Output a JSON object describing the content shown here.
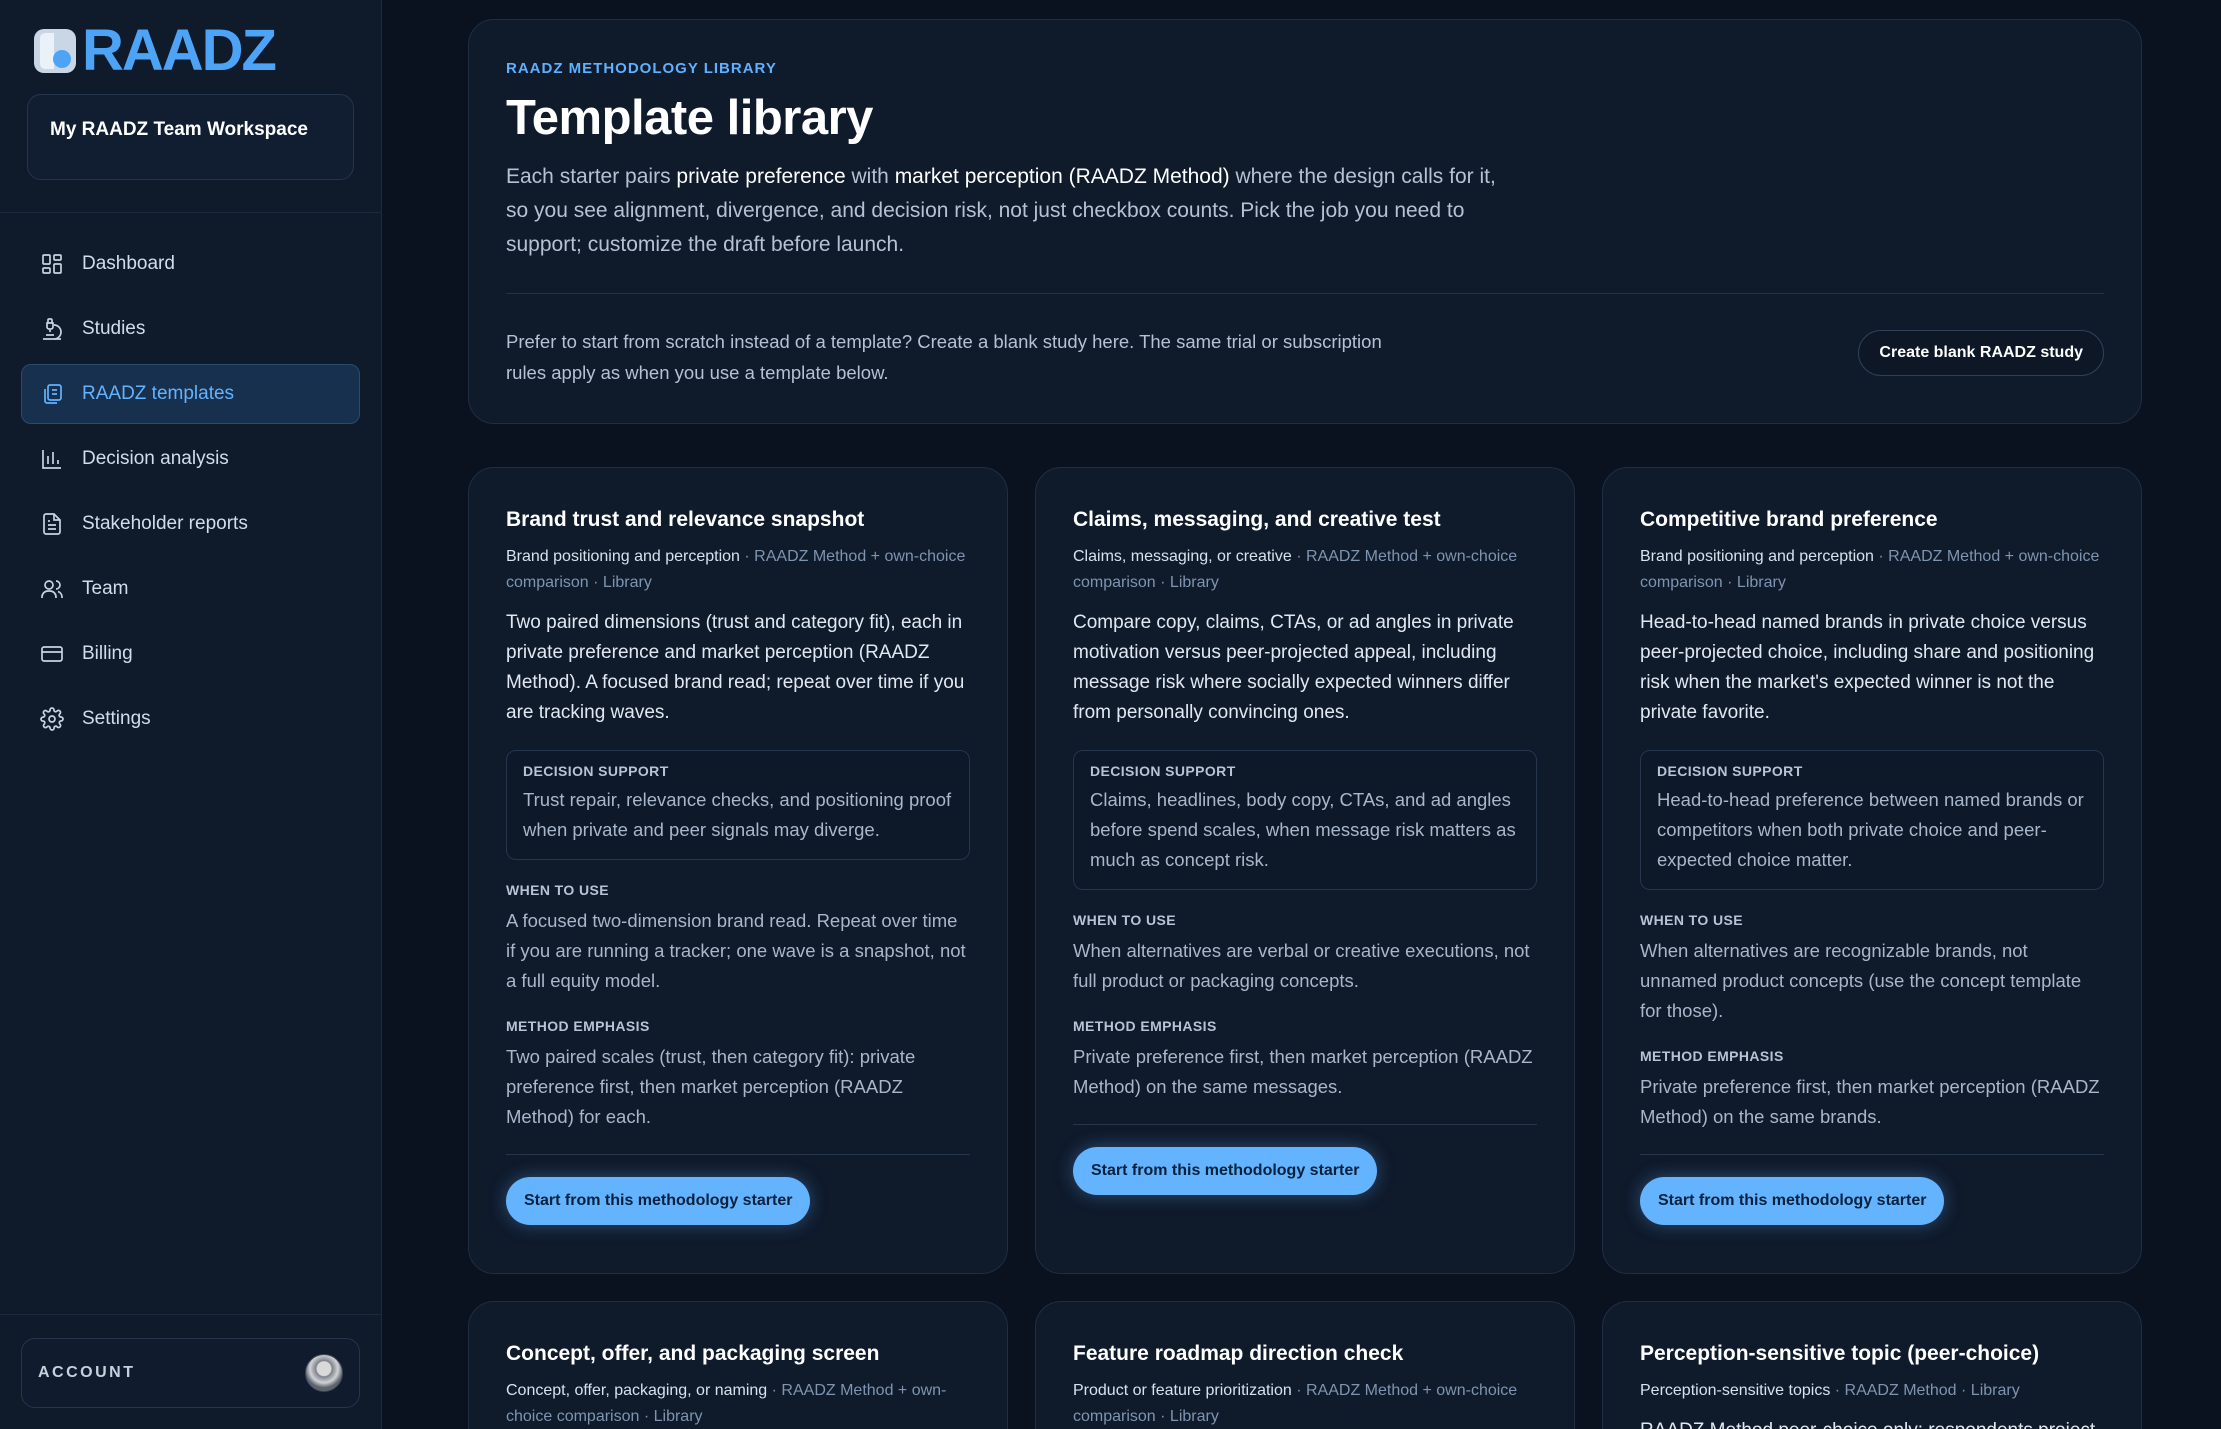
{
  "brand": {
    "name": "RAADZ",
    "accent": "#4da3f5"
  },
  "workspace": {
    "name": "My RAADZ Team Workspace"
  },
  "nav": {
    "items": [
      {
        "label": "Dashboard",
        "icon": "dashboard-grid-icon"
      },
      {
        "label": "Studies",
        "icon": "microscope-icon"
      },
      {
        "label": "RAADZ templates",
        "icon": "templates-icon",
        "active": true
      },
      {
        "label": "Decision analysis",
        "icon": "bar-chart-icon"
      },
      {
        "label": "Stakeholder reports",
        "icon": "document-icon"
      },
      {
        "label": "Team",
        "icon": "users-icon"
      },
      {
        "label": "Billing",
        "icon": "credit-card-icon"
      },
      {
        "label": "Settings",
        "icon": "gear-icon"
      }
    ]
  },
  "account": {
    "label": "ACCOUNT"
  },
  "hero": {
    "eyebrow": "RAADZ METHODOLOGY LIBRARY",
    "title": "Template library",
    "desc_1": "Each starter pairs ",
    "desc_bold_1": "private preference",
    "desc_2": " with ",
    "desc_bold_2": "market perception (RAADZ Method)",
    "desc_3": " where the design calls for it, so you see alignment, divergence, and decision risk, not just checkbox counts. Pick the job you need to support; customize the draft before launch.",
    "blank_text": "Prefer to start from scratch instead of a template? Create a blank study here. The same trial or subscription rules apply as when you use a template below.",
    "blank_button": "Create blank RAADZ study"
  },
  "labels": {
    "decision_support": "DECISION SUPPORT",
    "when_to_use": "WHEN TO USE",
    "method_emphasis": "METHOD EMPHASIS",
    "start_button": "Start from this methodology starter"
  },
  "cards": [
    {
      "title": "Brand trust and relevance snapshot",
      "category": "Brand positioning and perception",
      "meta": " · RAADZ Method + own-choice comparison · Library",
      "desc": "Two paired dimensions (trust and category fit), each in private preference and market perception (RAADZ Method). A focused brand read; repeat over time if you are tracking waves.",
      "decision": "Trust repair, relevance checks, and positioning proof when private and peer signals may diverge.",
      "when": "A focused two-dimension brand read. Repeat over time if you are running a tracker; one wave is a snapshot, not a full equity model.",
      "method": "Two paired scales (trust, then category fit): private preference first, then market perception (RAADZ Method) for each."
    },
    {
      "title": "Claims, messaging, and creative test",
      "category": "Claims, messaging, or creative",
      "meta": " · RAADZ Method + own-choice comparison · Library",
      "desc": "Compare copy, claims, CTAs, or ad angles in private motivation versus peer-projected appeal, including message risk where socially expected winners differ from personally convincing ones.",
      "decision": "Claims, headlines, body copy, CTAs, and ad angles before spend scales, when message risk matters as much as concept risk.",
      "when": "When alternatives are verbal or creative executions, not full product or packaging concepts.",
      "method": "Private preference first, then market perception (RAADZ Method) on the same messages."
    },
    {
      "title": "Competitive brand preference",
      "category": "Brand positioning and perception",
      "meta": " · RAADZ Method + own-choice comparison · Library",
      "desc": "Head-to-head named brands in private choice versus peer-projected choice, including share and positioning risk when the market's expected winner is not the private favorite.",
      "decision": "Head-to-head preference between named brands or competitors when both private choice and peer-expected choice matter.",
      "when": "When alternatives are recognizable brands, not unnamed product concepts (use the concept template for those).",
      "method": "Private preference first, then market perception (RAADZ Method) on the same brands."
    },
    {
      "title": "Concept, offer, and packaging screen",
      "category": "Concept, offer, packaging, or naming",
      "meta": " · RAADZ Method + own-choice comparison · Library"
    },
    {
      "title": "Feature roadmap direction check",
      "category": "Product or feature prioritization",
      "meta": " · RAADZ Method + own-choice comparison · Library"
    },
    {
      "title": "Perception-sensitive topic (peer-choice)",
      "category": "Perception-sensitive topics",
      "meta": " · RAADZ Method · Library",
      "desc": "RAADZ Method peer-choice only: respondents project"
    }
  ]
}
